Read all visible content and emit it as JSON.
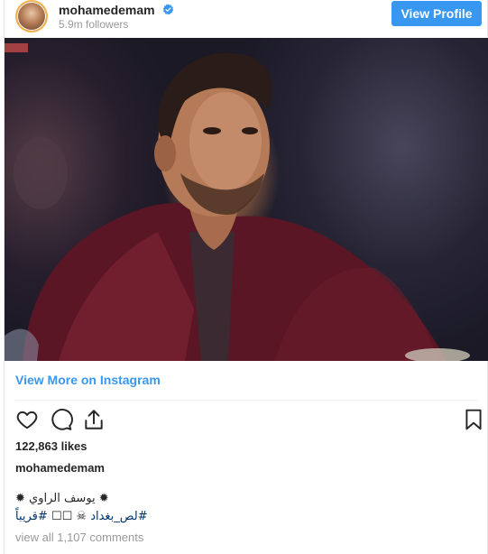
{
  "header": {
    "username": "mohamedemam",
    "followers": "5.9m followers",
    "view_profile_label": "View Profile",
    "verified_color": "#3897f0"
  },
  "post": {
    "view_more_label": "View More on Instagram",
    "likes": "122,863 likes",
    "caption_user": "mohamedemam",
    "caption_line1": "✹ يوسف الراوي ✹",
    "caption_hashtag1": "#لص_بغداد",
    "caption_middle": "☠ ☐☐",
    "caption_hashtag2": "#قريباً",
    "comments_label": "view all 1,107 comments"
  },
  "icons": [
    "heart-icon",
    "comment-icon",
    "share-icon",
    "bookmark-icon",
    "verified-icon"
  ],
  "colors": {
    "accent": "#3897f0",
    "hashtag": "#003569",
    "muted": "#999999",
    "text": "#262626"
  }
}
